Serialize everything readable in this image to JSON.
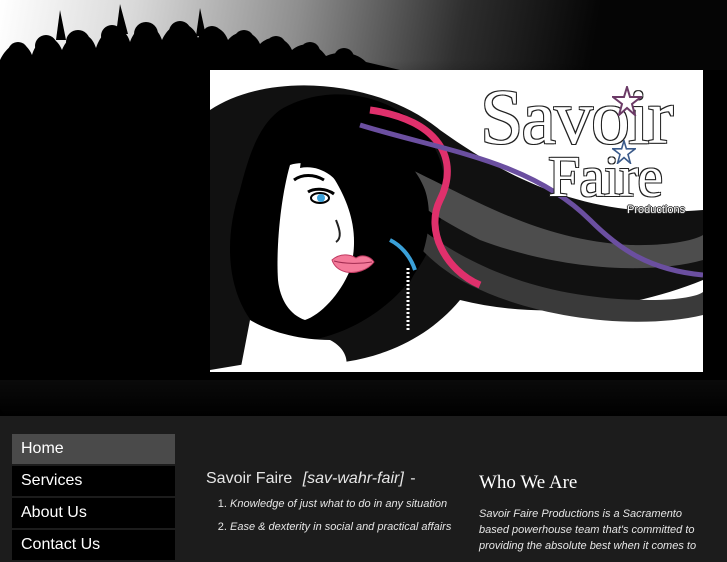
{
  "header": {
    "logo": {
      "line1": "Savoir",
      "line2": "Faire",
      "tagline": "Productions"
    }
  },
  "nav": {
    "items": [
      {
        "label": "Home",
        "active": true
      },
      {
        "label": "Services",
        "active": false
      },
      {
        "label": "About Us",
        "active": false
      },
      {
        "label": "Contact Us",
        "active": false
      }
    ]
  },
  "definition": {
    "word": "Savoir Faire",
    "pronunciation": "[sav-wahr-fair]",
    "dash": "-",
    "items": [
      "Knowledge of just what to do in any situation",
      "Ease & dexterity in social and practical affairs"
    ]
  },
  "who_we_are": {
    "title": "Who We Are",
    "text": "Savoir Faire Productions is a Sacramento based powerhouse team that's committed to providing the absolute best when it comes to"
  },
  "colors": {
    "page_bg": "#1c1c1c",
    "nav_active": "#4a4a4a",
    "nav_bg": "#000000",
    "hair_purple": "#6b4fa0",
    "hair_pink": "#e0306c",
    "lips": "#f47a9a",
    "eye": "#3aa0d8"
  }
}
